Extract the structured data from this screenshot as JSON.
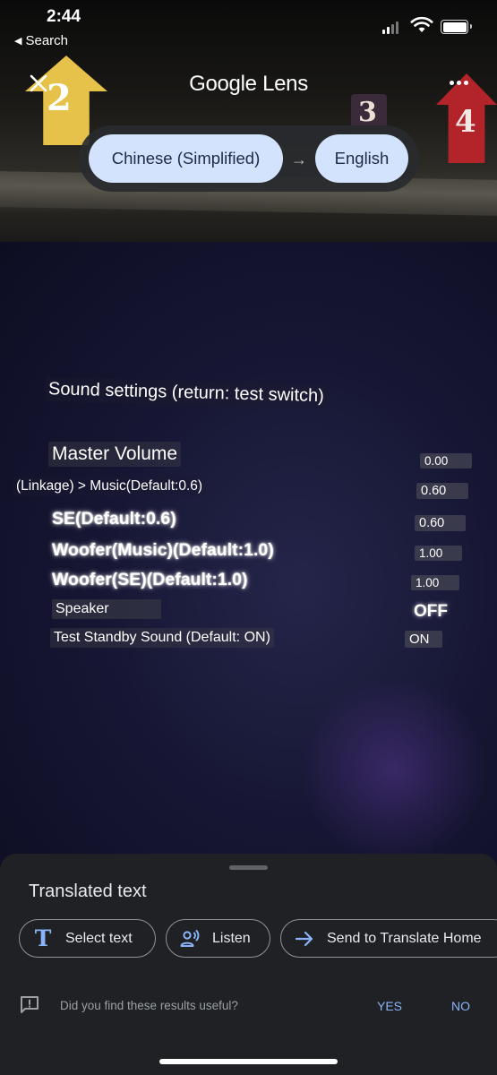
{
  "status_bar": {
    "time": "2:44",
    "back_label": "Search",
    "back_icon": "back-triangle-icon",
    "signal_icon": "cellular-signal-icon",
    "wifi_icon": "wifi-icon",
    "battery_icon": "battery-icon"
  },
  "header": {
    "title_brand": "Google",
    "title_product": "Lens",
    "close_icon": "close-icon",
    "more_icon": "more-options-icon"
  },
  "language_bar": {
    "source": "Chinese (Simplified)",
    "target": "English",
    "arrow": "→"
  },
  "camera_scene": {
    "tag_numbers": [
      "2",
      "3",
      "4"
    ]
  },
  "translated_overlay": {
    "title": "Sound settings (return: test switch)",
    "rows": [
      {
        "label": "Master Volume",
        "value": "0.00"
      },
      {
        "label": "(Linkage) > Music(Default:0.6)",
        "value": "0.60"
      },
      {
        "label": "SE(Default:0.6)",
        "value": "0.60"
      },
      {
        "label": "Woofer(Music)(Default:1.0)",
        "value": "1.00"
      },
      {
        "label": "Woofer(SE)(Default:1.0)",
        "value": "1.00"
      },
      {
        "label": "Speaker",
        "value": "OFF"
      },
      {
        "label": "Test Standby Sound (Default: ON)",
        "value": "ON"
      }
    ]
  },
  "bottom_sheet": {
    "title": "Translated text",
    "actions": [
      {
        "label": "Select text",
        "icon": "text-select-icon"
      },
      {
        "label": "Listen",
        "icon": "listen-icon"
      },
      {
        "label": "Send to Translate Home",
        "icon": "arrow-right-icon"
      }
    ],
    "feedback": {
      "question": "Did you find these results useful?",
      "yes": "YES",
      "no": "NO",
      "icon": "feedback-icon"
    }
  },
  "colors": {
    "accent": "#8ab4f8",
    "pill_bg": "#d3e3fd",
    "sheet_bg": "#202124"
  }
}
